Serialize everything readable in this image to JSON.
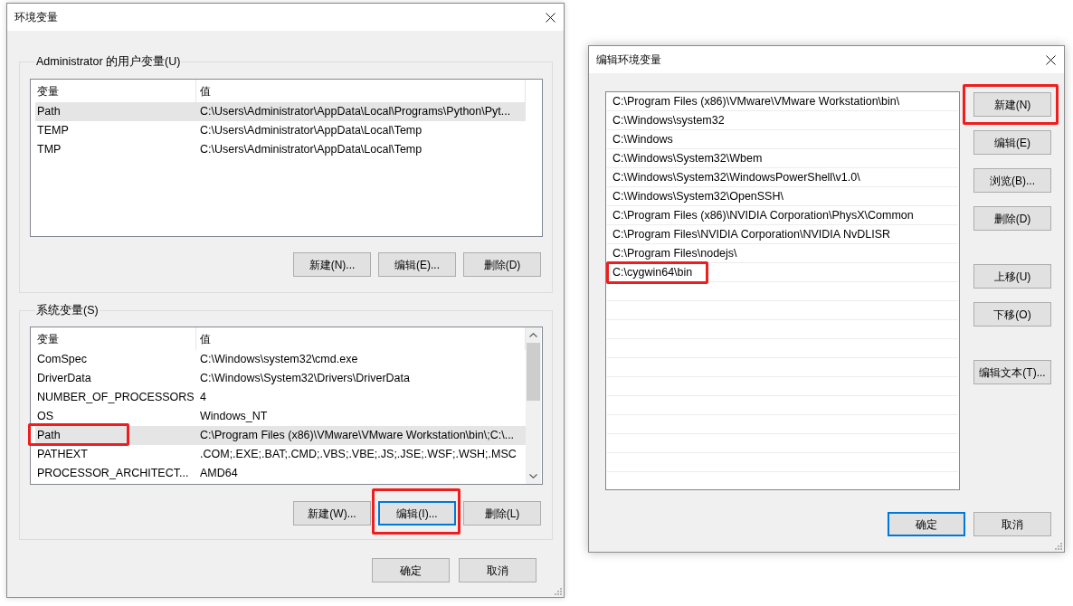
{
  "environment_dialog": {
    "title": "环境变量",
    "user_variables": {
      "label": "Administrator 的用户变量(U)",
      "columns": [
        "变量",
        "值"
      ],
      "rows": [
        {
          "name": "Path",
          "value": "C:\\Users\\Administrator\\AppData\\Local\\Programs\\Python\\Pyt...",
          "selected": true,
          "highlighted": false
        },
        {
          "name": "TEMP",
          "value": "C:\\Users\\Administrator\\AppData\\Local\\Temp",
          "selected": false,
          "highlighted": false
        },
        {
          "name": "TMP",
          "value": "C:\\Users\\Administrator\\AppData\\Local\\Temp",
          "selected": false,
          "highlighted": false
        }
      ],
      "buttons": [
        {
          "label": "新建(N)...",
          "focused": false,
          "highlighted": false
        },
        {
          "label": "编辑(E)...",
          "focused": false,
          "highlighted": false
        },
        {
          "label": "删除(D)",
          "focused": false,
          "highlighted": false
        }
      ]
    },
    "system_variables": {
      "label": "系统变量(S)",
      "columns": [
        "变量",
        "值"
      ],
      "rows": [
        {
          "name": "ComSpec",
          "value": "C:\\Windows\\system32\\cmd.exe",
          "selected": false,
          "highlighted": false
        },
        {
          "name": "DriverData",
          "value": "C:\\Windows\\System32\\Drivers\\DriverData",
          "selected": false,
          "highlighted": false
        },
        {
          "name": "NUMBER_OF_PROCESSORS",
          "value": "4",
          "selected": false,
          "highlighted": false
        },
        {
          "name": "OS",
          "value": "Windows_NT",
          "selected": false,
          "highlighted": false
        },
        {
          "name": "Path",
          "value": "C:\\Program Files (x86)\\VMware\\VMware Workstation\\bin\\;C:\\...",
          "selected": true,
          "highlighted": true
        },
        {
          "name": "PATHEXT",
          "value": ".COM;.EXE;.BAT;.CMD;.VBS;.VBE;.JS;.JSE;.WSF;.WSH;.MSC",
          "selected": false,
          "highlighted": false
        },
        {
          "name": "PROCESSOR_ARCHITECT...",
          "value": "AMD64",
          "selected": false,
          "highlighted": false
        }
      ],
      "buttons": [
        {
          "label": "新建(W)...",
          "focused": false,
          "highlighted": false
        },
        {
          "label": "编辑(I)...",
          "focused": true,
          "highlighted": true
        },
        {
          "label": "删除(L)",
          "focused": false,
          "highlighted": false
        }
      ]
    },
    "buttons": [
      {
        "label": "确定",
        "focused": false
      },
      {
        "label": "取消",
        "focused": false
      }
    ]
  },
  "edit_dialog": {
    "title": "编辑环境变量",
    "entries": [
      {
        "text": "C:\\Program Files (x86)\\VMware\\VMware Workstation\\bin\\",
        "selected": false,
        "highlighted": false
      },
      {
        "text": "C:\\Windows\\system32",
        "selected": false,
        "highlighted": false
      },
      {
        "text": "C:\\Windows",
        "selected": false,
        "highlighted": false
      },
      {
        "text": "C:\\Windows\\System32\\Wbem",
        "selected": false,
        "highlighted": false
      },
      {
        "text": "C:\\Windows\\System32\\WindowsPowerShell\\v1.0\\",
        "selected": false,
        "highlighted": false
      },
      {
        "text": "C:\\Windows\\System32\\OpenSSH\\",
        "selected": false,
        "highlighted": false
      },
      {
        "text": "C:\\Program Files (x86)\\NVIDIA Corporation\\PhysX\\Common",
        "selected": false,
        "highlighted": false
      },
      {
        "text": "C:\\Program Files\\NVIDIA Corporation\\NVIDIA NvDLISR",
        "selected": false,
        "highlighted": false
      },
      {
        "text": "C:\\Program Files\\nodejs\\",
        "selected": false,
        "highlighted": false
      },
      {
        "text": "C:\\cygwin64\\bin",
        "selected": false,
        "highlighted": true
      }
    ],
    "side_button_groups": [
      {
        "buttons": [
          {
            "label": "新建(N)",
            "focused": false,
            "highlighted": true
          },
          {
            "label": "编辑(E)",
            "focused": false,
            "highlighted": false
          },
          {
            "label": "浏览(B)...",
            "focused": false,
            "highlighted": false
          },
          {
            "label": "删除(D)",
            "focused": false,
            "highlighted": false
          }
        ]
      },
      {
        "buttons": [
          {
            "label": "上移(U)",
            "focused": false,
            "highlighted": false
          },
          {
            "label": "下移(O)",
            "focused": false,
            "highlighted": false
          }
        ]
      },
      {
        "buttons": [
          {
            "label": "编辑文本(T)...",
            "focused": false,
            "highlighted": false
          }
        ]
      }
    ],
    "buttons": [
      {
        "label": "确定",
        "focused": true
      },
      {
        "label": "取消",
        "focused": false
      }
    ]
  }
}
